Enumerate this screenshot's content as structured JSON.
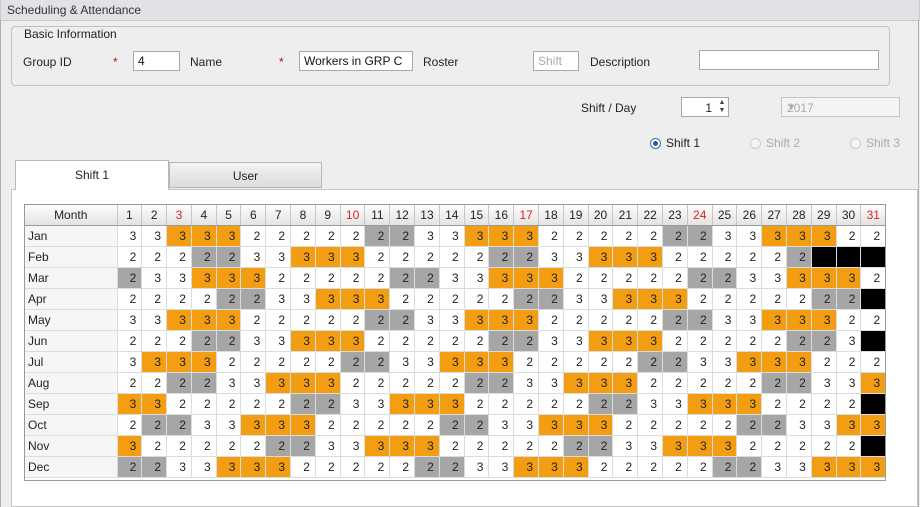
{
  "window": {
    "title": "Scheduling & Attendance"
  },
  "basic_info": {
    "legend": "Basic Information",
    "group_id_label": "Group ID",
    "group_id_value": "4",
    "required_mark": "*",
    "name_label": "Name",
    "name_value": "Workers in GRP C",
    "roster_label": "Roster",
    "roster_placeholder": "Shift",
    "description_label": "Description",
    "description_value": ""
  },
  "shift_per_day": {
    "label": "Shift / Day",
    "value": "1",
    "year": "2017"
  },
  "shift_radios": [
    {
      "label": "Shift 1",
      "selected": true,
      "enabled": true
    },
    {
      "label": "Shift 2",
      "selected": false,
      "enabled": false
    },
    {
      "label": "Shift 3",
      "selected": false,
      "enabled": false
    }
  ],
  "tabs": [
    {
      "label": "Shift 1",
      "active": true
    },
    {
      "label": "User",
      "active": false
    }
  ],
  "grid": {
    "month_header": "Month",
    "red_days": [
      3,
      10,
      17,
      24,
      31
    ],
    "days": [
      "1",
      "2",
      "3",
      "4",
      "5",
      "6",
      "7",
      "8",
      "9",
      "10",
      "11",
      "12",
      "13",
      "14",
      "15",
      "16",
      "17",
      "18",
      "19",
      "20",
      "21",
      "22",
      "23",
      "24",
      "25",
      "26",
      "27",
      "28",
      "29",
      "30",
      "31"
    ],
    "rows": [
      {
        "month": "Jan",
        "cells": [
          "3w",
          "3w",
          "3o",
          "3o",
          "3o",
          "2w",
          "2w",
          "2w",
          "2w",
          "2w",
          "2g",
          "2g",
          "3w",
          "3w",
          "3o",
          "3o",
          "3o",
          "2w",
          "2w",
          "2w",
          "2w",
          "2w",
          "2g",
          "2g",
          "3w",
          "3w",
          "3o",
          "3o",
          "3o",
          "2w",
          "2w"
        ]
      },
      {
        "month": "Feb",
        "cells": [
          "2w",
          "2w",
          "2w",
          "2g",
          "2g",
          "3w",
          "3w",
          "3o",
          "3o",
          "3o",
          "2w",
          "2w",
          "2w",
          "2w",
          "2w",
          "2g",
          "2g",
          "3w",
          "3w",
          "3o",
          "3o",
          "3o",
          "2w",
          "2w",
          "2w",
          "2w",
          "2w",
          "2g",
          "x",
          "x",
          "x"
        ]
      },
      {
        "month": "Mar",
        "cells": [
          "2g",
          "3w",
          "3w",
          "3o",
          "3o",
          "3o",
          "2w",
          "2w",
          "2w",
          "2w",
          "2w",
          "2g",
          "2g",
          "3w",
          "3w",
          "3o",
          "3o",
          "3o",
          "2w",
          "2w",
          "2w",
          "2w",
          "2w",
          "2g",
          "2g",
          "3w",
          "3w",
          "3o",
          "3o",
          "3o",
          "2w"
        ]
      },
      {
        "month": "Apr",
        "cells": [
          "2w",
          "2w",
          "2w",
          "2w",
          "2g",
          "2g",
          "3w",
          "3w",
          "3o",
          "3o",
          "3o",
          "2w",
          "2w",
          "2w",
          "2w",
          "2w",
          "2g",
          "2g",
          "3w",
          "3w",
          "3o",
          "3o",
          "3o",
          "2w",
          "2w",
          "2w",
          "2w",
          "2w",
          "2g",
          "2g",
          "x"
        ]
      },
      {
        "month": "May",
        "cells": [
          "3w",
          "3w",
          "3o",
          "3o",
          "3o",
          "2w",
          "2w",
          "2w",
          "2w",
          "2w",
          "2g",
          "2g",
          "3w",
          "3w",
          "3o",
          "3o",
          "3o",
          "2w",
          "2w",
          "2w",
          "2w",
          "2w",
          "2g",
          "2g",
          "3w",
          "3w",
          "3o",
          "3o",
          "3o",
          "2w",
          "2w"
        ]
      },
      {
        "month": "Jun",
        "cells": [
          "2w",
          "2w",
          "2w",
          "2g",
          "2g",
          "3w",
          "3w",
          "3o",
          "3o",
          "3o",
          "2w",
          "2w",
          "2w",
          "2w",
          "2w",
          "2g",
          "2g",
          "3w",
          "3w",
          "3o",
          "3o",
          "3o",
          "2w",
          "2w",
          "2w",
          "2w",
          "2w",
          "2g",
          "2g",
          "3w",
          "x"
        ]
      },
      {
        "month": "Jul",
        "cells": [
          "3w",
          "3o",
          "3o",
          "3o",
          "2w",
          "2w",
          "2w",
          "2w",
          "2w",
          "2g",
          "2g",
          "3w",
          "3w",
          "3o",
          "3o",
          "3o",
          "2w",
          "2w",
          "2w",
          "2w",
          "2w",
          "2g",
          "2g",
          "3w",
          "3w",
          "3o",
          "3o",
          "3o",
          "2w",
          "2w",
          "2w"
        ]
      },
      {
        "month": "Aug",
        "cells": [
          "2w",
          "2w",
          "2g",
          "2g",
          "3w",
          "3w",
          "3o",
          "3o",
          "3o",
          "2w",
          "2w",
          "2w",
          "2w",
          "2w",
          "2g",
          "2g",
          "3w",
          "3w",
          "3o",
          "3o",
          "3o",
          "2w",
          "2w",
          "2w",
          "2w",
          "2w",
          "2g",
          "2g",
          "3w",
          "3w",
          "3o"
        ]
      },
      {
        "month": "Sep",
        "cells": [
          "3o",
          "3o",
          "2w",
          "2w",
          "2w",
          "2w",
          "2w",
          "2g",
          "2g",
          "3w",
          "3w",
          "3o",
          "3o",
          "3o",
          "2w",
          "2w",
          "2w",
          "2w",
          "2w",
          "2g",
          "2g",
          "3w",
          "3w",
          "3o",
          "3o",
          "3o",
          "2w",
          "2w",
          "2w",
          "2w",
          "x"
        ]
      },
      {
        "month": "Oct",
        "cells": [
          "2w",
          "2g",
          "2g",
          "3w",
          "3w",
          "3o",
          "3o",
          "3o",
          "2w",
          "2w",
          "2w",
          "2w",
          "2w",
          "2g",
          "2g",
          "3w",
          "3w",
          "3o",
          "3o",
          "3o",
          "2w",
          "2w",
          "2w",
          "2w",
          "2w",
          "2g",
          "2g",
          "3w",
          "3w",
          "3o",
          "3o"
        ]
      },
      {
        "month": "Nov",
        "cells": [
          "3o",
          "2w",
          "2w",
          "2w",
          "2w",
          "2w",
          "2g",
          "2g",
          "3w",
          "3w",
          "3o",
          "3o",
          "3o",
          "2w",
          "2w",
          "2w",
          "2w",
          "2w",
          "2g",
          "2g",
          "3w",
          "3w",
          "3o",
          "3o",
          "3o",
          "2w",
          "2w",
          "2w",
          "2w",
          "2w",
          "x"
        ]
      },
      {
        "month": "Dec",
        "cells": [
          "2g",
          "2g",
          "3w",
          "3w",
          "3o",
          "3o",
          "3o",
          "2w",
          "2w",
          "2w",
          "2w",
          "2w",
          "2g",
          "2g",
          "3w",
          "3w",
          "3o",
          "3o",
          "3o",
          "2w",
          "2w",
          "2w",
          "2w",
          "2w",
          "2g",
          "2g",
          "3w",
          "3w",
          "3o",
          "3o",
          "3o"
        ]
      }
    ]
  },
  "colors": {
    "orange": "#f39d12",
    "gray": "#a6a6a6",
    "black": "#000000",
    "red_day": "#d22222"
  }
}
